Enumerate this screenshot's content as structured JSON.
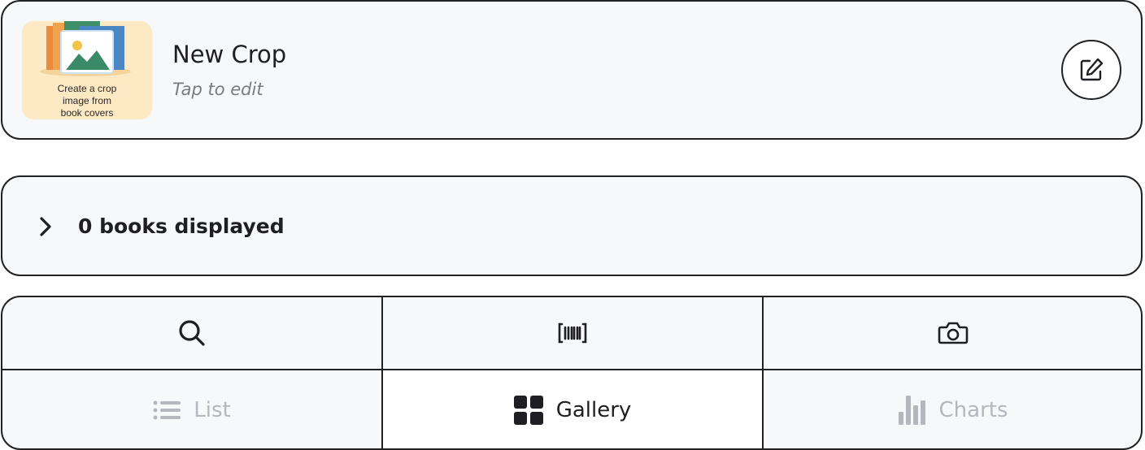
{
  "crop": {
    "thumbnail_caption_line1": "Create a crop",
    "thumbnail_caption_line2": "image from",
    "thumbnail_caption_line3": "book covers",
    "title": "New Crop",
    "subtitle": "Tap to edit",
    "edit_icon": "edit-square-icon"
  },
  "books": {
    "label": "0 books displayed",
    "expand_icon": "chevron-right-icon"
  },
  "toolbar": {
    "actions": [
      {
        "icon": "search-icon"
      },
      {
        "icon": "barcode-icon"
      },
      {
        "icon": "camera-icon"
      }
    ],
    "views": [
      {
        "label": "List",
        "icon": "list-icon",
        "active": false
      },
      {
        "label": "Gallery",
        "icon": "grid-icon",
        "active": true
      },
      {
        "label": "Charts",
        "icon": "bar-chart-icon",
        "active": false
      }
    ]
  },
  "colors": {
    "card_bg": "#f7f8fa",
    "border": "#222222",
    "thumb_bg": "#fde9c4",
    "muted_text": "#7a7b80",
    "inactive": "#b4b7bd"
  }
}
